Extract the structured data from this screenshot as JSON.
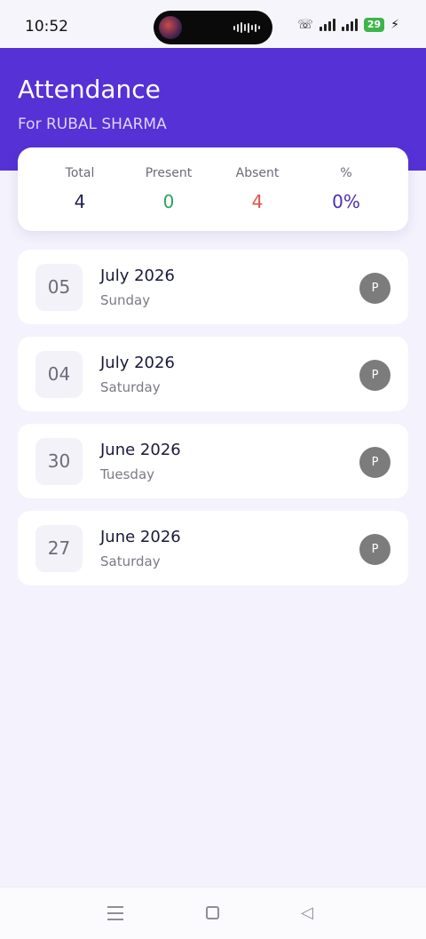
{
  "status_bar": {
    "time": "10:52",
    "battery": "29"
  },
  "header": {
    "title": "Attendance",
    "subtitle": "For RUBAL SHARMA"
  },
  "summary": {
    "total_label": "Total",
    "total_value": "4",
    "present_label": "Present",
    "present_value": "0",
    "absent_label": "Absent",
    "absent_value": "4",
    "percent_label": "%",
    "percent_value": "0%"
  },
  "colors": {
    "header": "#5631d6",
    "total": "#1d1d4f",
    "present": "#27a65a",
    "absent": "#d9534f",
    "percent": "#4a2fb0",
    "badge": "#7c7c7c"
  },
  "records": [
    {
      "day": "05",
      "month_year": "July 2026",
      "weekday": "Sunday",
      "status": "P"
    },
    {
      "day": "04",
      "month_year": "July 2026",
      "weekday": "Saturday",
      "status": "P"
    },
    {
      "day": "30",
      "month_year": "June 2026",
      "weekday": "Tuesday",
      "status": "P"
    },
    {
      "day": "27",
      "month_year": "June 2026",
      "weekday": "Saturday",
      "status": "P"
    }
  ],
  "icons": {
    "call": "wifi-call-icon",
    "signal": "signal-icon",
    "charging": "bolt-icon",
    "menu": "menu-icon",
    "home": "home-icon",
    "back": "back-icon"
  }
}
